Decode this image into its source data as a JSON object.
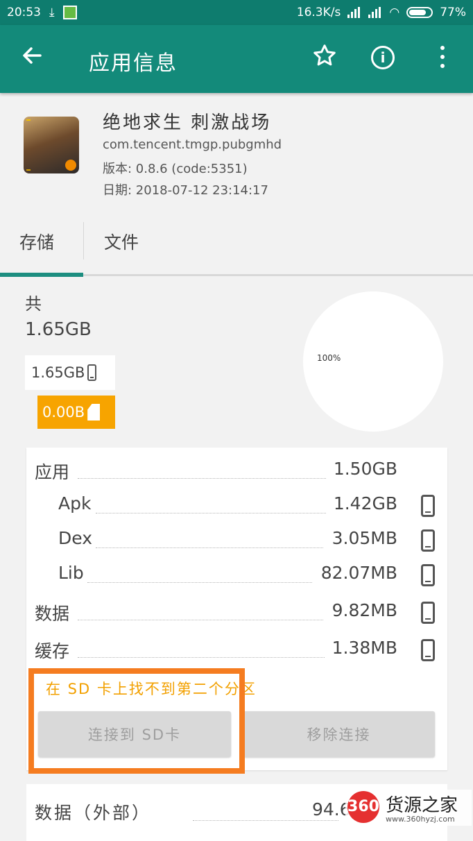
{
  "status_bar": {
    "time": "20:53",
    "speed": "16.3K/s",
    "battery": "77%"
  },
  "toolbar": {
    "title": "应用信息",
    "back_icon": "arrow-left-icon",
    "star_icon": "star-outline-icon",
    "info_icon": "info-circle-icon",
    "more_icon": "more-vert-icon"
  },
  "app": {
    "name": "绝地求生 刺激战场",
    "package": "com.tencent.tmgp.pubgmhd",
    "version": "版本: 0.8.6 (code:5351)",
    "date": "日期: 2018-07-12 23:14:17"
  },
  "tabs": [
    {
      "label": "存储",
      "active": true
    },
    {
      "label": "文件",
      "active": false
    }
  ],
  "storage": {
    "total_label": "共",
    "total_value": "1.65GB",
    "internal": "1.65GB",
    "sd": "0.00B",
    "pie_label": "100%",
    "pie_fraction": 1.0,
    "sd_color": "#f7a400"
  },
  "details": {
    "rows": [
      {
        "label": "应用",
        "value": "1.50GB",
        "indent": false,
        "phone": false
      },
      {
        "label": "Apk",
        "value": "1.42GB",
        "indent": true,
        "phone": true
      },
      {
        "label": "Dex",
        "value": "3.05MB",
        "indent": true,
        "phone": true
      },
      {
        "label": "Lib",
        "value": "82.07MB",
        "indent": true,
        "phone": true
      },
      {
        "label": "数据",
        "value": "9.82MB",
        "indent": false,
        "phone": true
      },
      {
        "label": "缓存",
        "value": "1.38MB",
        "indent": false,
        "phone": true
      }
    ],
    "sd_note": "在 SD 卡上找不到第二个分区",
    "connect_button": "连接到 SD卡",
    "remove_button": "移除连接"
  },
  "external": {
    "label": "数据（外部）",
    "value": "94.6"
  },
  "watermark": {
    "logo": "360",
    "brand": "货源之家",
    "url": "www.360hyzj.com"
  },
  "accent_color": "#138a7a",
  "highlight_color": "#f57c20"
}
